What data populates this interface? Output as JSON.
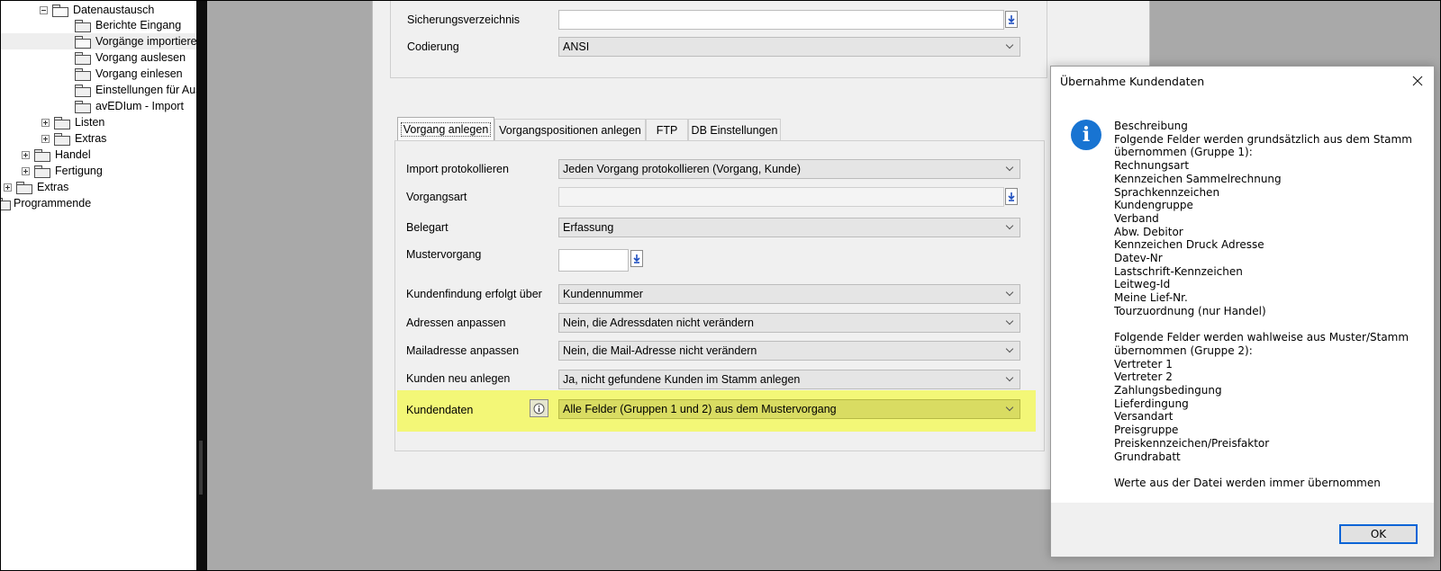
{
  "tree": {
    "items": [
      {
        "label": "Datenaustausch",
        "expander": "minus",
        "open": true
      },
      {
        "label": "Berichte Eingang"
      },
      {
        "label": "Vorgänge importieren",
        "selected": true,
        "open": true
      },
      {
        "label": "Vorgang auslesen"
      },
      {
        "label": "Vorgang einlesen"
      },
      {
        "label": "Einstellungen für Aus"
      },
      {
        "label": "avEDIum - Import"
      },
      {
        "label": "Listen",
        "expander": "plus"
      },
      {
        "label": "Extras",
        "expander": "plus"
      },
      {
        "label": "Handel",
        "expander": "plus"
      },
      {
        "label": "Fertigung",
        "expander": "plus"
      },
      {
        "label": "Extras",
        "expander": "plus"
      },
      {
        "label": "Programmende"
      }
    ]
  },
  "top_group": {
    "sicherung_label": "Sicherungsverzeichnis",
    "sicherung_value": "",
    "codierung_label": "Codierung",
    "codierung_value": "ANSI"
  },
  "tabs": [
    "Vorgang anlegen",
    "Vorgangspositionen anlegen",
    "FTP",
    "DB Einstellungen"
  ],
  "form": {
    "import_protokollieren_label": "Import protokollieren",
    "import_protokollieren_value": "Jeden Vorgang protokollieren (Vorgang, Kunde)",
    "vorgangsart_label": "Vorgangsart",
    "vorgangsart_value": "",
    "belegart_label": "Belegart",
    "belegart_value": "Erfassung",
    "mustervorgang_label": "Mustervorgang",
    "mustervorgang_value": "",
    "kundenfindung_label": "Kundenfindung erfolgt über",
    "kundenfindung_value": "Kundennummer",
    "adressen_label": "Adressen anpassen",
    "adressen_value": "Nein, die Adressdaten nicht verändern",
    "mailadresse_label": "Mailadresse anpassen",
    "mailadresse_value": "Nein, die Mail-Adresse nicht verändern",
    "kunden_neu_label": "Kunden neu anlegen",
    "kunden_neu_value": "Ja, nicht gefundene Kunden im Stamm anlegen",
    "kundendaten_label": "Kundendaten",
    "kundendaten_value": "Alle Felder (Gruppen 1 und 2) aus dem Mustervorgang"
  },
  "colors": {
    "highlight": "#f3f777",
    "info_blue": "#1874d2",
    "ok_border": "#0a64d6",
    "workspace": "#a9a9a9"
  },
  "dialog": {
    "title": "Übernahme Kundendaten",
    "lines": [
      "Beschreibung",
      "Folgende Felder werden grundsätzlich aus dem Stamm",
      "übernommen (Gruppe 1):",
      "Rechnungsart",
      "Kennzeichen Sammelrechnung",
      "Sprachkennzeichen",
      "Kundengruppe",
      "Verband",
      "Abw. Debitor",
      "Kennzeichen Druck Adresse",
      "Datev-Nr",
      "Lastschrift-Kennzeichen",
      "Leitweg-Id",
      "Meine Lief-Nr.",
      "Tourzuordnung (nur Handel)",
      "",
      "Folgende Felder werden wahlweise aus Muster/Stamm",
      "übernommen (Gruppe 2):",
      "Vertreter 1",
      "Vertreter 2",
      "Zahlungsbedingung",
      "Lieferdingung",
      "Versandart",
      "Preisgruppe",
      "Preiskennzeichen/Preisfaktor",
      "Grundrabatt",
      "",
      "Werte aus der Datei werden immer übernommen"
    ],
    "ok_label": "OK"
  }
}
